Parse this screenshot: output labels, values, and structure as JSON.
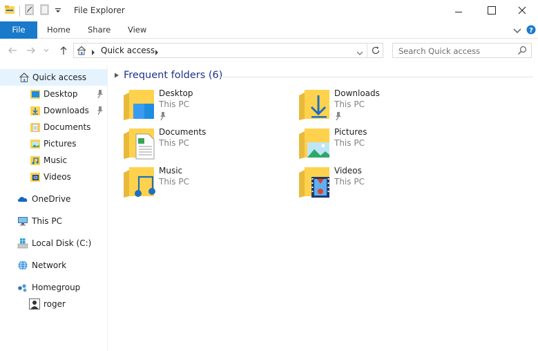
{
  "window": {
    "title": "File Explorer",
    "controls": [
      "minimize-icon",
      "maximize-icon",
      "close-icon"
    ]
  },
  "ribbon": {
    "tabs": [
      {
        "label": "File"
      },
      {
        "label": "Home"
      },
      {
        "label": "Share"
      },
      {
        "label": "View"
      }
    ]
  },
  "address": {
    "location": "Quick access",
    "search_placeholder": "Search Quick access"
  },
  "nav": {
    "quick_access": "Quick access",
    "pinned": [
      {
        "label": "Desktop",
        "pinned": true
      },
      {
        "label": "Downloads",
        "pinned": true
      },
      {
        "label": "Documents",
        "pinned": false
      },
      {
        "label": "Pictures",
        "pinned": false
      },
      {
        "label": "Music",
        "pinned": false
      },
      {
        "label": "Videos",
        "pinned": false
      }
    ],
    "onedrive": "OneDrive",
    "this_pc": "This PC",
    "local_disk": "Local Disk (C:)",
    "network": "Network",
    "homegroup": "Homegroup",
    "user": "roger"
  },
  "main": {
    "group_title": "Frequent folders (6)",
    "folders": [
      {
        "name": "Desktop",
        "location": "This PC",
        "pinned": true
      },
      {
        "name": "Downloads",
        "location": "This PC",
        "pinned": true
      },
      {
        "name": "Documents",
        "location": "This PC",
        "pinned": false
      },
      {
        "name": "Pictures",
        "location": "This PC",
        "pinned": false
      },
      {
        "name": "Music",
        "location": "This PC",
        "pinned": false
      },
      {
        "name": "Videos",
        "location": "This PC",
        "pinned": false
      }
    ]
  },
  "colors": {
    "accent": "#1979ca",
    "selected_bg": "#e5f3ff",
    "folder_yellow": "#ffd24d",
    "group_title": "#1e3287"
  }
}
